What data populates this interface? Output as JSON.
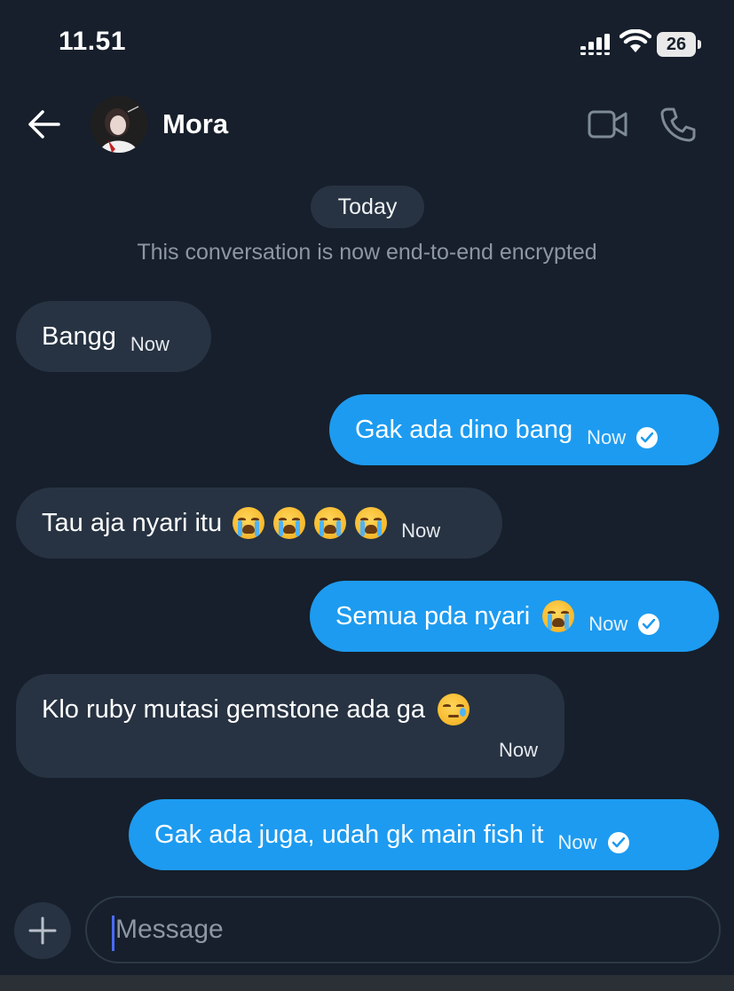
{
  "status_bar": {
    "time": "11.51",
    "battery": "26"
  },
  "header": {
    "contact_name": "Mora"
  },
  "conversation": {
    "date_label": "Today",
    "encryption_notice": "This conversation is now end-to-end encrypted"
  },
  "messages": [
    {
      "direction": "incoming",
      "text": "Bangg",
      "time": "Now"
    },
    {
      "direction": "outgoing",
      "text": "Gak ada dino bang",
      "time": "Now",
      "read": true
    },
    {
      "direction": "incoming",
      "text": "Tau aja nyari itu",
      "time": "Now",
      "emoji": [
        "loudly-crying-face",
        "loudly-crying-face",
        "loudly-crying-face",
        "loudly-crying-face"
      ]
    },
    {
      "direction": "outgoing",
      "text": "Semua pda nyari",
      "time": "Now",
      "read": true,
      "emoji": [
        "loudly-crying-face"
      ]
    },
    {
      "direction": "incoming",
      "text": "Klo ruby mutasi gemstone ada ga",
      "time": "Now",
      "emoji": [
        "sad-but-relieved-face"
      ]
    },
    {
      "direction": "outgoing",
      "text": "Gak ada juga, udah gk main fish it",
      "time": "Now",
      "read": true
    }
  ],
  "composer": {
    "placeholder": "Message"
  },
  "colors": {
    "background": "#161f2b",
    "incoming_bubble": "#273342",
    "outgoing_bubble": "#1d9bf0"
  }
}
